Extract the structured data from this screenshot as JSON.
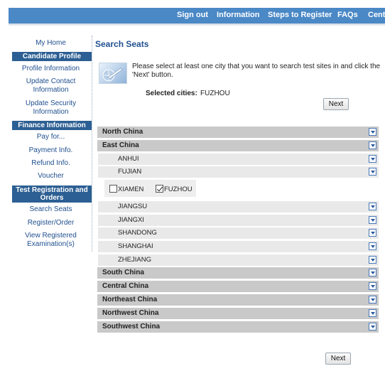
{
  "nav": {
    "items": [
      "Sign out",
      "Information",
      "Steps to Register",
      "FAQs",
      "Cente"
    ]
  },
  "sidebar": {
    "home": "My Home",
    "candidate_profile": {
      "heading": "Candidate Profile",
      "items": [
        "Profile Information",
        "Update Contact Information",
        "Update Security Information"
      ]
    },
    "finance": {
      "heading": "Finance Information",
      "items": [
        "Pay for...",
        "Payment Info.",
        "Refund Info.",
        "Voucher"
      ]
    },
    "test_registration": {
      "heading": "Test Registration and Orders",
      "items": [
        "Search Seats",
        "Register/Order",
        "View Registered Examination(s)"
      ]
    }
  },
  "main": {
    "title": "Search Seats",
    "instruction": "Please select at least one city that you want to search test sites in and click the 'Next' button.",
    "selected_label": "Selected cities:",
    "selected_value": "FUZHOU",
    "next_label": "Next"
  },
  "regions": [
    {
      "name": "North China"
    },
    {
      "name": "East China",
      "provinces": [
        "ANHUI",
        "FUJIAN",
        "JIANGSU",
        "JIANGXI",
        "SHANDONG",
        "SHANGHAI",
        "ZHEJIANG"
      ]
    },
    {
      "name": "South China"
    },
    {
      "name": "Central China"
    },
    {
      "name": "Northeast China"
    },
    {
      "name": "Northwest China"
    },
    {
      "name": "Southwest China"
    }
  ],
  "cities": [
    {
      "name": "XIAMEN",
      "checked": false
    },
    {
      "name": "FUZHOU",
      "checked": true
    }
  ],
  "colors": {
    "nav_bg": "#4a88c6",
    "sidebar_heading_bg": "#2c5f93",
    "link": "#1f4f8f",
    "region_row": "#c9c9c9",
    "province_row": "#e9e9e9"
  }
}
